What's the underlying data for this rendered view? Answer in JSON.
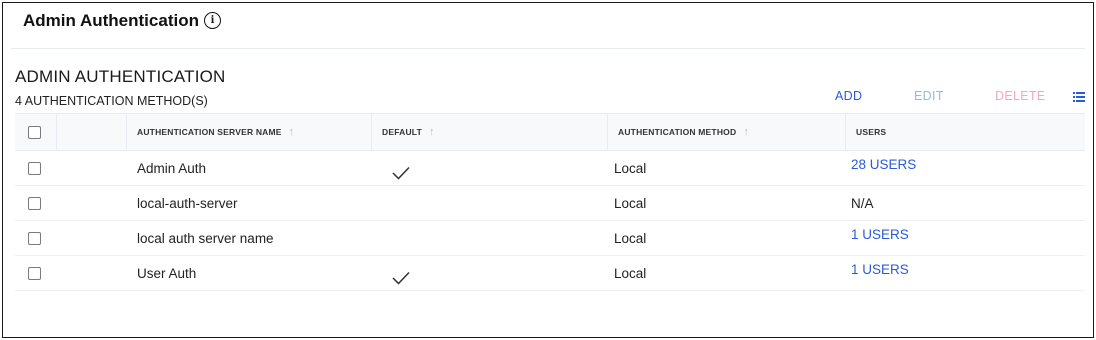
{
  "page": {
    "title": "Admin Authentication",
    "info_icon": "info-circle-icon"
  },
  "section": {
    "title": "ADMIN AUTHENTICATION",
    "count_text": "4 AUTHENTICATION METHOD(S)"
  },
  "toolbar": {
    "add_label": "ADD",
    "edit_label": "EDIT",
    "delete_label": "DELETE",
    "columns_icon": "list-icon",
    "colors": {
      "add": "#2a5bd7",
      "edit_disabled": "#9bb5e6",
      "delete_disabled": "#f3a8c2"
    }
  },
  "table": {
    "columns": [
      {
        "label": ""
      },
      {
        "label": ""
      },
      {
        "label": "AUTHENTICATION SERVER NAME",
        "sortable": true
      },
      {
        "label": "DEFAULT",
        "sortable": true
      },
      {
        "label": "AUTHENTICATION METHOD",
        "sortable": true
      },
      {
        "label": "USERS",
        "sortable": false
      }
    ],
    "rows": [
      {
        "name": "Admin Auth",
        "default": true,
        "method": "Local",
        "users": "28 USERS",
        "users_link": true
      },
      {
        "name": "local-auth-server",
        "default": false,
        "method": "Local",
        "users": "N/A",
        "users_link": false
      },
      {
        "name": "local auth server name",
        "default": false,
        "method": "Local",
        "users": "1 USERS",
        "users_link": true
      },
      {
        "name": "User Auth",
        "default": true,
        "method": "Local",
        "users": "1 USERS",
        "users_link": true
      }
    ]
  }
}
